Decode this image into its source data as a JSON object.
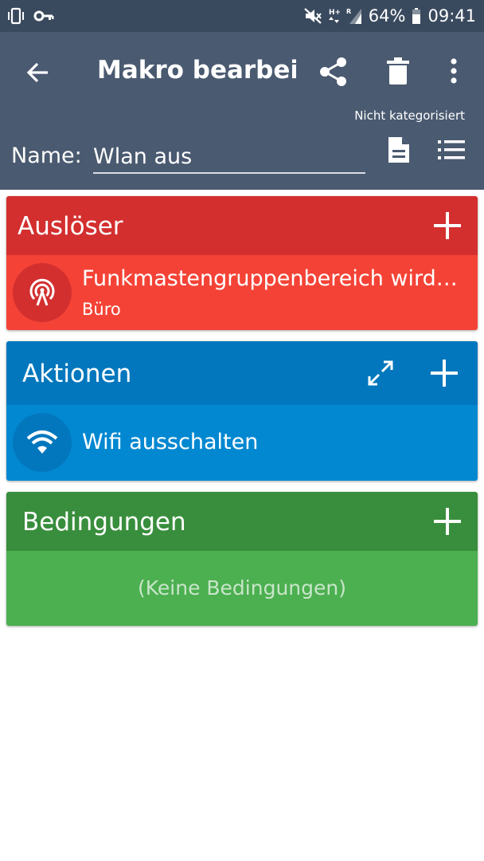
{
  "status_bar": {
    "battery": "64%",
    "time": "09:41"
  },
  "app_bar": {
    "title": "Makro bearbei…",
    "category": "Nicht kategorisiert",
    "name_label": "Name:",
    "name_value": "Wlan aus"
  },
  "triggers": {
    "header": "Auslöser",
    "items": [
      {
        "title": "Funkmastengruppenbereich wird…",
        "subtitle": "Büro"
      }
    ]
  },
  "actions": {
    "header": "Aktionen",
    "items": [
      {
        "title": "Wifi ausschalten"
      }
    ]
  },
  "conditions": {
    "header": "Bedingungen",
    "empty_text": "(Keine Bedingungen)"
  },
  "colors": {
    "status_bar": "#3a4a5e",
    "app_bar": "#4a5a70",
    "triggers_header": "#d32f2f",
    "triggers_body": "#f44336",
    "actions_header": "#0277bd",
    "actions_body": "#0288d1",
    "conditions_header": "#388e3c",
    "conditions_body": "#4caf50"
  }
}
